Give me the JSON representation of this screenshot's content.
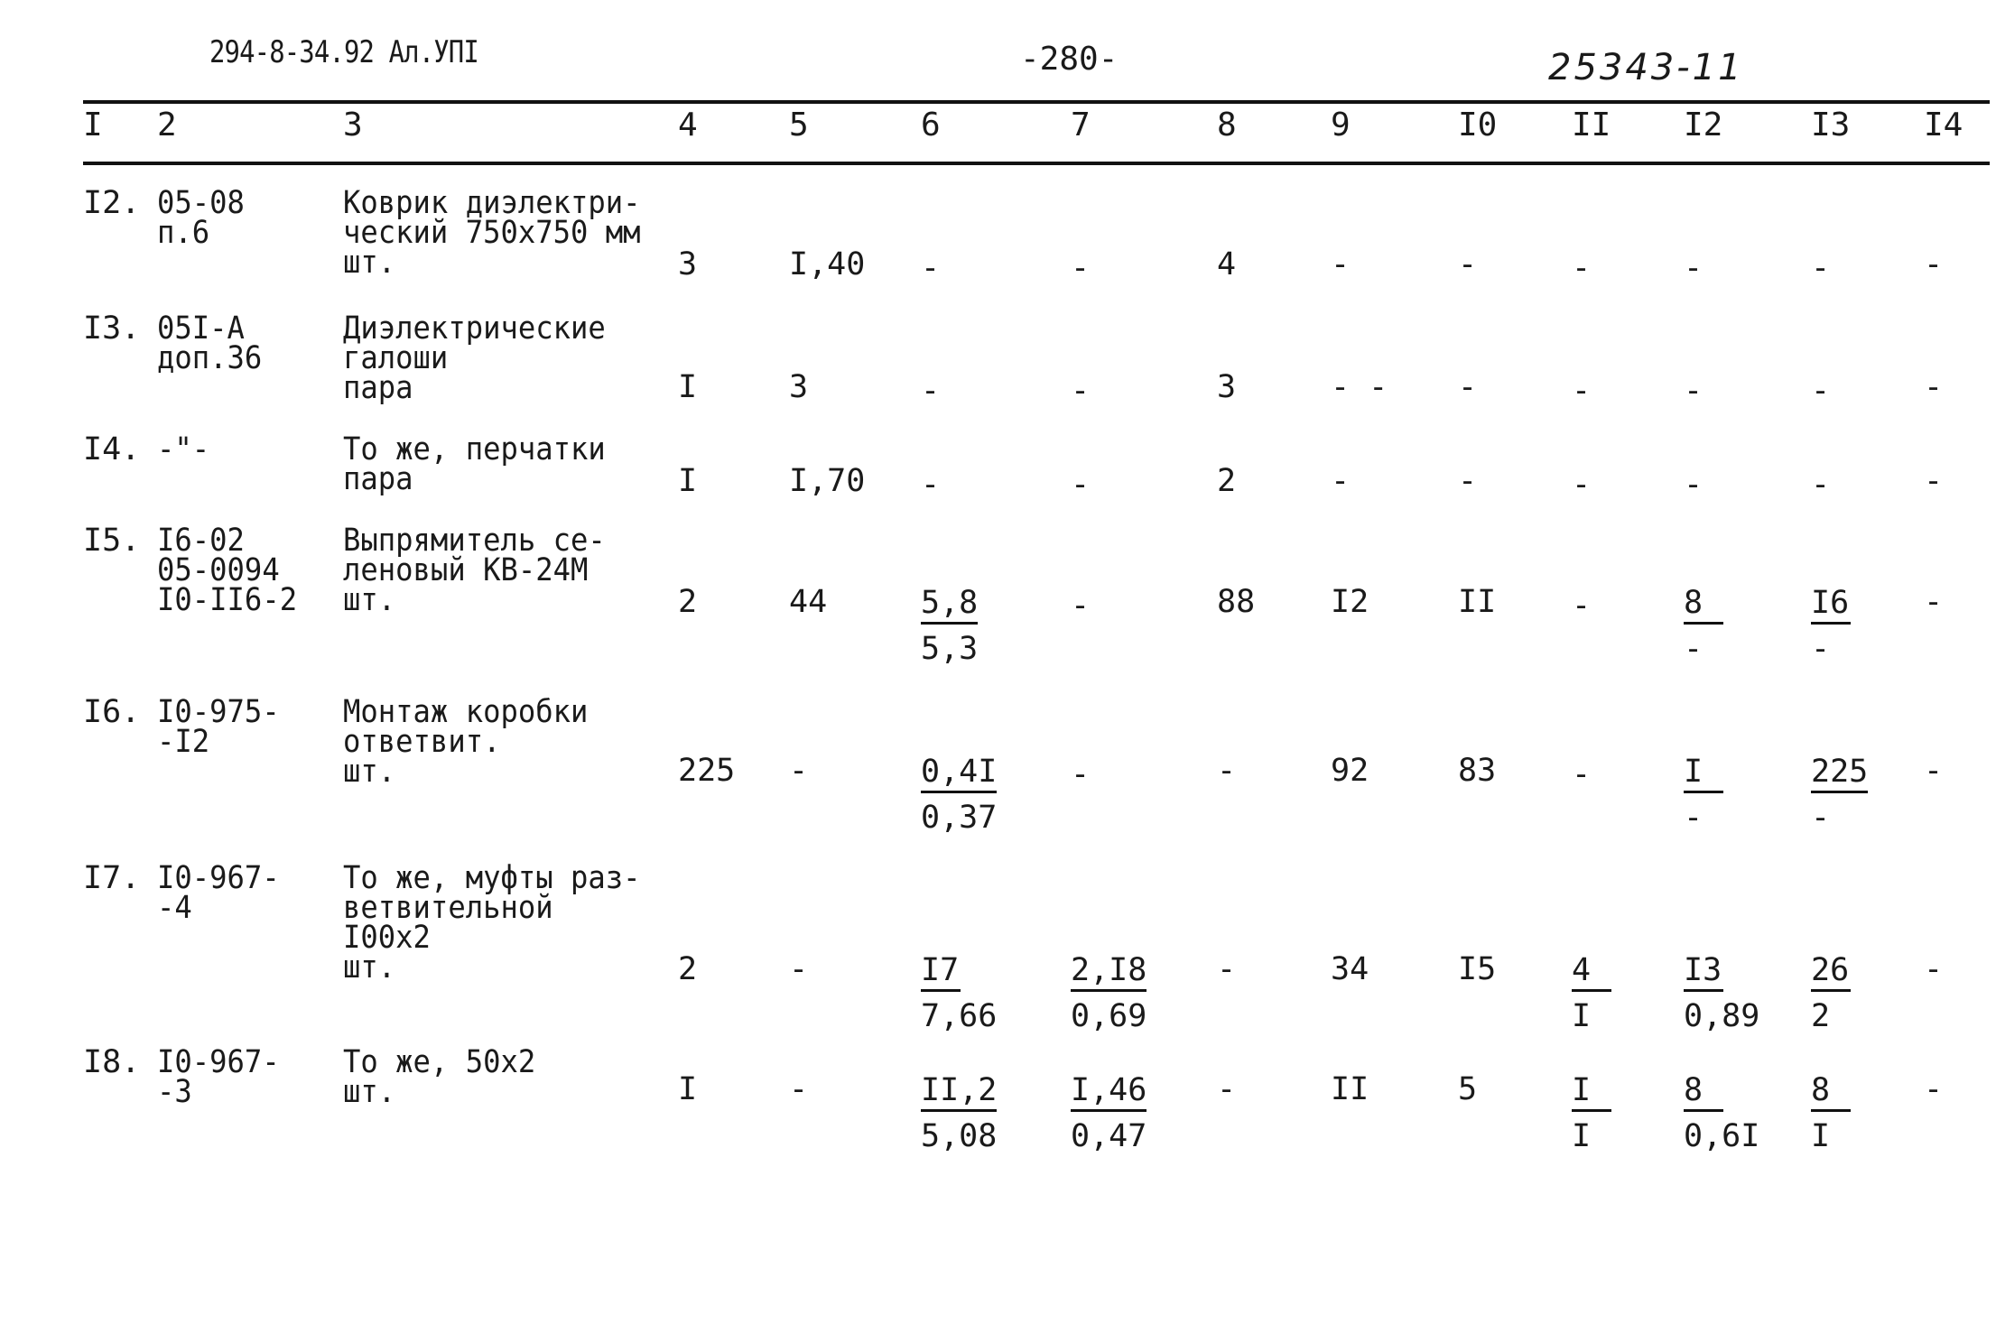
{
  "header": {
    "doc_code": "294-8-34.92  Ал.УПI",
    "page_number": "-280-",
    "handwritten_ref": "25343-11"
  },
  "columns": [
    "I",
    "2",
    "3",
    "4",
    "5",
    "6",
    "7",
    "8",
    "9",
    "I0",
    "II",
    "I2",
    "I3",
    "I4"
  ],
  "rows": [
    {
      "no": "I2.",
      "code": [
        "05-08",
        "п.6"
      ],
      "name": [
        "Коврик диэлектри-",
        "ческий 750х750 мм",
        "шт."
      ],
      "c4": "3",
      "c5": "I,40",
      "c6": {
        "num": "-",
        "den": ""
      },
      "c7": {
        "num": "-",
        "den": ""
      },
      "c8": "4",
      "c9": "-",
      "c10": "-",
      "c11": {
        "num": "-",
        "den": ""
      },
      "c12": {
        "num": "-",
        "den": ""
      },
      "c13": {
        "num": "-",
        "den": ""
      },
      "c14": "-"
    },
    {
      "no": "I3.",
      "code": [
        "05I-А",
        "доп.36"
      ],
      "name": [
        "Диэлектрические",
        "галоши",
        "пара"
      ],
      "c4": "I",
      "c5": "3",
      "c6": {
        "num": "-",
        "den": ""
      },
      "c7": {
        "num": "-",
        "den": ""
      },
      "c8": "3",
      "c9": "- -",
      "c10": "-",
      "c11": {
        "num": "-",
        "den": ""
      },
      "c12": {
        "num": "-",
        "den": ""
      },
      "c13": {
        "num": "-",
        "den": ""
      },
      "c14": "-"
    },
    {
      "no": "I4.",
      "code": [
        "-\"-"
      ],
      "name": [
        "То же, перчатки",
        "пара"
      ],
      "c4": "I",
      "c5": "I,70",
      "c6": {
        "num": "-",
        "den": ""
      },
      "c7": {
        "num": "-",
        "den": ""
      },
      "c8": "2",
      "c9": "-",
      "c10": "-",
      "c11": {
        "num": "-",
        "den": ""
      },
      "c12": {
        "num": "-",
        "den": ""
      },
      "c13": {
        "num": "-",
        "den": ""
      },
      "c14": "-"
    },
    {
      "no": "I5.",
      "code": [
        "I6-02",
        "05-0094",
        "I0-II6-2"
      ],
      "name": [
        "Выпрямитель се-",
        "леновый КВ-24М",
        "шт."
      ],
      "c4": "2",
      "c5": "44",
      "c6": {
        "num": "5,8",
        "den": "5,3"
      },
      "c7": {
        "num": "-",
        "den": ""
      },
      "c8": "88",
      "c9": "I2",
      "c10": "II",
      "c11": {
        "num": "-",
        "den": ""
      },
      "c12": {
        "num": "8",
        "den": "-"
      },
      "c13": {
        "num": "I6",
        "den": "-"
      },
      "c14": "-"
    },
    {
      "no": "I6.",
      "code": [
        "I0-975-",
        "-I2"
      ],
      "name": [
        "Монтаж коробки",
        "ответвит.",
        "шт."
      ],
      "c4": "225",
      "c5": "-",
      "c6": {
        "num": "0,4I",
        "den": "0,37"
      },
      "c7": {
        "num": "-",
        "den": ""
      },
      "c8": "-",
      "c9": "92",
      "c10": "83",
      "c11": {
        "num": "-",
        "den": ""
      },
      "c12": {
        "num": "I",
        "den": "-"
      },
      "c13": {
        "num": "225",
        "den": "-"
      },
      "c14": "-"
    },
    {
      "no": "I7.",
      "code": [
        "I0-967-",
        "-4"
      ],
      "name": [
        "То же, муфты раз-",
        "ветвительной",
        "I00х2",
        "шт."
      ],
      "c4": "2",
      "c5": "-",
      "c6": {
        "num": "I7",
        "den": "7,66"
      },
      "c7": {
        "num": "2,I8",
        "den": "0,69"
      },
      "c8": "-",
      "c9": "34",
      "c10": "I5",
      "c11": {
        "num": "4",
        "den": "I"
      },
      "c12": {
        "num": "I3",
        "den": "0,89"
      },
      "c13": {
        "num": "26",
        "den": "2"
      },
      "c14": "-"
    },
    {
      "no": "I8.",
      "code": [
        "I0-967-",
        "-3"
      ],
      "name": [
        "То же, 50х2",
        "шт."
      ],
      "c4": "I",
      "c5": "-",
      "c6": {
        "num": "II,2",
        "den": "5,08"
      },
      "c7": {
        "num": "I,46",
        "den": "0,47"
      },
      "c8": "-",
      "c9": "II",
      "c10": "5",
      "c11": {
        "num": "I",
        "den": "I"
      },
      "c12": {
        "num": "8",
        "den": "0,6I"
      },
      "c13": {
        "num": "8",
        "den": "I"
      },
      "c14": "-"
    }
  ]
}
